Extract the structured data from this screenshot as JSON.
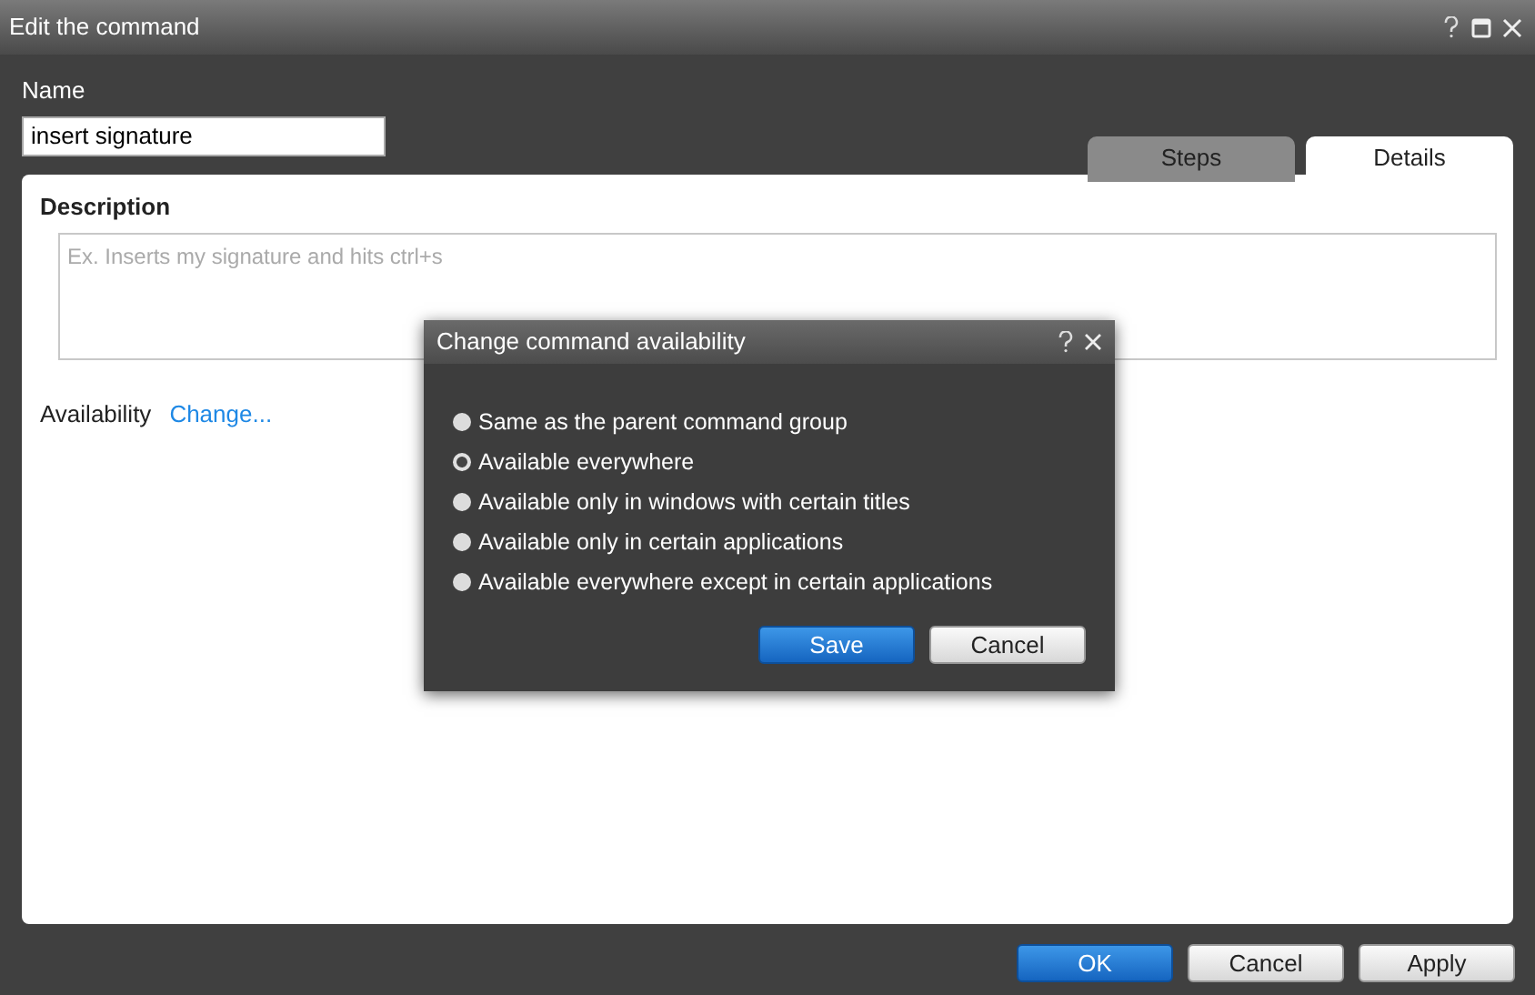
{
  "window": {
    "title": "Edit the command"
  },
  "name_field": {
    "label": "Name",
    "value": "insert signature"
  },
  "tabs": [
    {
      "label": "Steps",
      "selected": false
    },
    {
      "label": "Details",
      "selected": true
    }
  ],
  "description": {
    "label": "Description",
    "placeholder": "Ex. Inserts my signature and hits ctrl+s"
  },
  "availability": {
    "label": "Availability",
    "link": "Change..."
  },
  "dialog": {
    "title": "Change command availability",
    "options": [
      {
        "label": "Same as the parent command group",
        "selected": false
      },
      {
        "label": "Available everywhere",
        "selected": true
      },
      {
        "label": "Available only in windows with certain titles",
        "selected": false
      },
      {
        "label": "Available only in certain applications",
        "selected": false
      },
      {
        "label": "Available everywhere except in certain applications",
        "selected": false
      }
    ],
    "buttons": [
      {
        "label": "Save",
        "kind": "primary"
      },
      {
        "label": "Cancel",
        "kind": "default"
      }
    ]
  },
  "buttons": [
    {
      "label": "OK",
      "kind": "primary"
    },
    {
      "label": "Cancel",
      "kind": "default"
    },
    {
      "label": "Apply",
      "kind": "default"
    }
  ]
}
